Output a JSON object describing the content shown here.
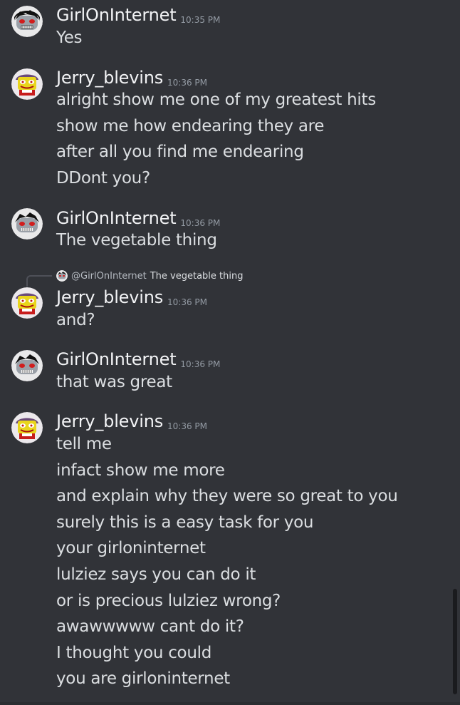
{
  "messages": [
    {
      "username": "GirlOnInternet",
      "timestamp": "10:35 PM",
      "avatar_icon": "girl-avatar-icon",
      "lines": [
        "Yes"
      ]
    },
    {
      "username": "Jerry_blevins",
      "timestamp": "10:36 PM",
      "avatar_icon": "jerry-avatar-icon",
      "lines": [
        "alright show me one of my greatest hits",
        "show me how endearing they are",
        "after all you find me endearing",
        "DDont you?"
      ]
    },
    {
      "username": "GirlOnInternet",
      "timestamp": "10:36 PM",
      "avatar_icon": "girl-avatar-icon",
      "lines": [
        "The vegetable thing"
      ]
    },
    {
      "username": "Jerry_blevins",
      "timestamp": "10:36 PM",
      "avatar_icon": "jerry-avatar-icon",
      "reply": {
        "user": "@GirlOnInternet",
        "text": "The vegetable thing"
      },
      "lines": [
        "and?"
      ]
    },
    {
      "username": "GirlOnInternet",
      "timestamp": "10:36 PM",
      "avatar_icon": "girl-avatar-icon",
      "lines": [
        "that was great"
      ]
    },
    {
      "username": "Jerry_blevins",
      "timestamp": "10:36 PM",
      "avatar_icon": "jerry-avatar-icon",
      "lines": [
        "tell me",
        "infact show me more",
        "and explain why they were so great to you",
        "surely this is a easy task for you",
        "your girloninternet",
        "lulziez says you can do it",
        "or is precious lulziez wrong?",
        "awawwwww cant do it?",
        "I thought you could",
        "you are girloninternet"
      ]
    }
  ],
  "colors": {
    "background": "#313338",
    "username": "#f2f3f5",
    "text": "#dbdee1",
    "timestamp": "#949ba4"
  }
}
